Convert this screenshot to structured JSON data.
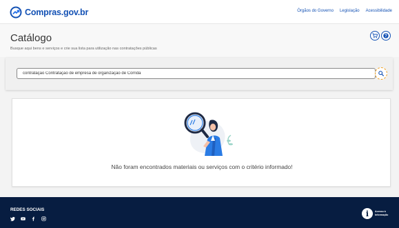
{
  "header": {
    "logo_text": "Compras.gov.br",
    "links": [
      "Órgãos do Governo",
      "Legislação",
      "Acessibilidade"
    ]
  },
  "page": {
    "title": "Catálogo",
    "subtitle": "Busque aqui bens e serviços e crie sua lista para utilização nas contratações públicas"
  },
  "search": {
    "value": "contratação Contratação de empresa de organização de Corrida"
  },
  "results": {
    "empty_message": "Não foram encontrados materiais ou serviços com o critério informado!"
  },
  "footer": {
    "social_title": "REDES SOCIAIS",
    "social_icons": [
      "twitter-icon",
      "youtube-icon",
      "facebook-icon",
      "instagram-icon"
    ],
    "access_info_text": "Acesso à Informação"
  },
  "colors": {
    "brand_blue": "#1351b4",
    "footer_navy": "#071d41",
    "focus_orange": "#f0a020"
  }
}
